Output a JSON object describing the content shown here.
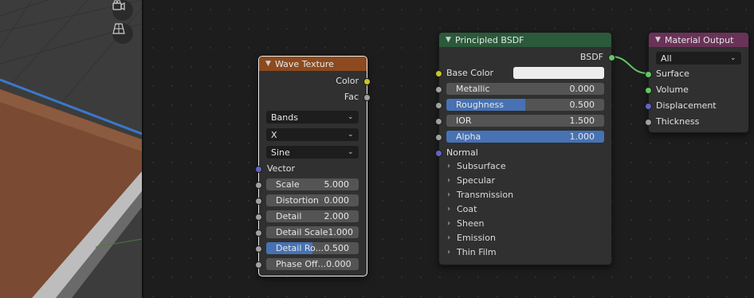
{
  "colors": {
    "wave_header": "#8c4a1e",
    "bsdf_header": "#2a5a3a",
    "output_header": "#6a3258",
    "socket_color": "#c7c729",
    "socket_float": "#a1a1a1",
    "socket_vector": "#6363c7",
    "socket_shader": "#63c763",
    "accent_blue": "#4772b3",
    "wood": "#7a4a32"
  },
  "viewport": {
    "icons": [
      "camera-icon",
      "grid-icon"
    ]
  },
  "wave_texture": {
    "title": "Wave Texture",
    "outputs": [
      "Color",
      "Fac"
    ],
    "dropdowns": [
      "Bands",
      "X",
      "Sine"
    ],
    "vector_label": "Vector",
    "fields": [
      {
        "label": "Scale",
        "value": "5.000",
        "fill": 0
      },
      {
        "label": "Distortion",
        "value": "0.000",
        "fill": 0
      },
      {
        "label": "Detail",
        "value": "2.000",
        "fill": 0
      },
      {
        "label": "Detail Scale",
        "value": "1.000",
        "fill": 0
      },
      {
        "label": "Detail Ro...",
        "value": "0.500",
        "fill": 0.5
      },
      {
        "label": "Phase Off...",
        "value": "0.000",
        "fill": 0
      }
    ]
  },
  "principled": {
    "title": "Principled BSDF",
    "output": "BSDF",
    "base_color_label": "Base Color",
    "fields": [
      {
        "label": "Metallic",
        "value": "0.000",
        "fill": 0
      },
      {
        "label": "Roughness",
        "value": "0.500",
        "fill": 0.5
      },
      {
        "label": "IOR",
        "value": "1.500",
        "fill": 0
      },
      {
        "label": "Alpha",
        "value": "1.000",
        "fill": 1.0
      }
    ],
    "normal_label": "Normal",
    "panels": [
      "Subsurface",
      "Specular",
      "Transmission",
      "Coat",
      "Sheen",
      "Emission",
      "Thin Film"
    ]
  },
  "material_output": {
    "title": "Material Output",
    "target": "All",
    "inputs": [
      "Surface",
      "Volume",
      "Displacement",
      "Thickness"
    ]
  }
}
